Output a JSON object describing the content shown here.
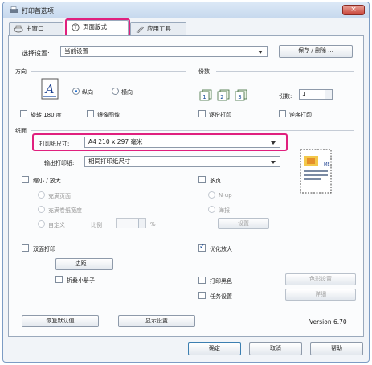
{
  "window": {
    "title": "打印首选项",
    "close_symbol": "×"
  },
  "tabs": [
    {
      "label": "主窗口",
      "icon": "main-window-icon",
      "active": false
    },
    {
      "label": "页面版式",
      "icon": "page-layout-icon",
      "active": true
    },
    {
      "label": "应用工具",
      "icon": "utility-icon",
      "active": false
    }
  ],
  "preset": {
    "label": "选择设置:",
    "value": "当前设置",
    "save_button": "保存 / 删除 ..."
  },
  "orientation": {
    "group_label": "方向",
    "portrait": "纵向",
    "landscape": "横向",
    "selected": "portrait",
    "rotate180": "旋转 180 度",
    "mirror": "镜像图像"
  },
  "copies": {
    "group_label": "份数",
    "count_label": "份数:",
    "count_value": "1",
    "collate": "逐份打印",
    "reverse": "逆序打印"
  },
  "paper": {
    "group_label": "纸面",
    "size_label": "打印纸尺寸:",
    "size_value": "A4 210 x 297 毫米",
    "output_label": "输出打印纸:",
    "output_value": "相同打印纸尺寸"
  },
  "reduce_enlarge": {
    "label": "缩小 / 放大",
    "fit_page": "充满页面",
    "fit_roll": "充满卷纸宽度",
    "custom": "自定义",
    "scale_label": "比例",
    "scale_unit": "%"
  },
  "multipage": {
    "label": "多页",
    "nup": "N-up",
    "poster": "海报",
    "settings_button": "设置"
  },
  "duplex": {
    "label": "双面打印",
    "margins_button": "边距 ...",
    "folded_booklet": "折叠小册子"
  },
  "options": {
    "optimize_enlarge": "优化放大",
    "print_black": "打印黑色",
    "color_settings_button": "色彩设置",
    "job_settings": "任务设置",
    "details_button": "详细"
  },
  "footer": {
    "restore_defaults": "恢复默认值",
    "show_settings": "显示设置",
    "version": "Version 6.70"
  },
  "dialog_buttons": {
    "ok": "确定",
    "cancel": "取消",
    "help": "帮助"
  },
  "colors": {
    "highlight": "#e0207e",
    "title_bar": "#c7d9ee",
    "close_button": "#c9453a"
  }
}
